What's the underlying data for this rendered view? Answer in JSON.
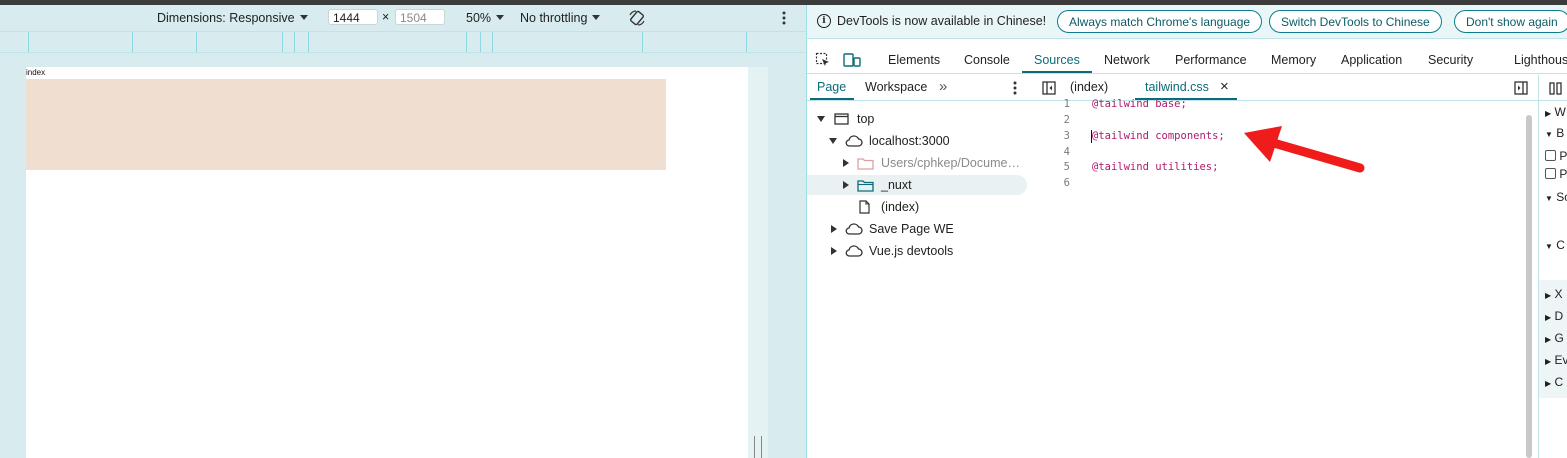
{
  "device_toolbar": {
    "dimensions_label": "Dimensions: Responsive",
    "width_value": "1444",
    "times": "×",
    "height_value": "1504",
    "zoom": "50%",
    "throttling": "No throttling",
    "rotate_icon": "rotate-icon",
    "more_icon": "more-vert-icon"
  },
  "viewport": {
    "page_label": "index",
    "block_color": "#f0dfd0"
  },
  "infobar": {
    "message": "DevTools is now available in Chinese!",
    "buttons": [
      "Always match Chrome's language",
      "Switch DevTools to Chinese",
      "Don't show again"
    ]
  },
  "main_tabs": [
    "Elements",
    "Console",
    "Sources",
    "Network",
    "Performance",
    "Memory",
    "Application",
    "Security",
    "Lighthouse"
  ],
  "active_tab": "Sources",
  "navigator": {
    "tabs": [
      "Page",
      "Workspace"
    ],
    "more": "»",
    "tree": [
      "top",
      "localhost:3000",
      "Users/cphkep/Docume…",
      "_nuxt",
      "(index)",
      "Save Page WE",
      "Vue.js devtools"
    ]
  },
  "editor": {
    "tabs": [
      "(index)",
      "tailwind.css"
    ],
    "close": "×",
    "lines": [
      {
        "n": "1",
        "code": "@tailwind base;"
      },
      {
        "n": "2",
        "code": ""
      },
      {
        "n": "3",
        "code": "@tailwind components;"
      },
      {
        "n": "4",
        "code": ""
      },
      {
        "n": "5",
        "code": "@tailwind utilities;"
      },
      {
        "n": "6",
        "code": ""
      }
    ]
  },
  "sidebar_letters": [
    "W",
    "B",
    "P",
    "P",
    "Sc",
    "C",
    "X",
    "D",
    "G",
    "Ev",
    "C"
  ],
  "annotation": {
    "arrow_color": "#f01c1c"
  },
  "colors": {
    "accent": "#0b6c78",
    "keyword": "#b0196e",
    "info_bg": "#e9f6f8"
  }
}
